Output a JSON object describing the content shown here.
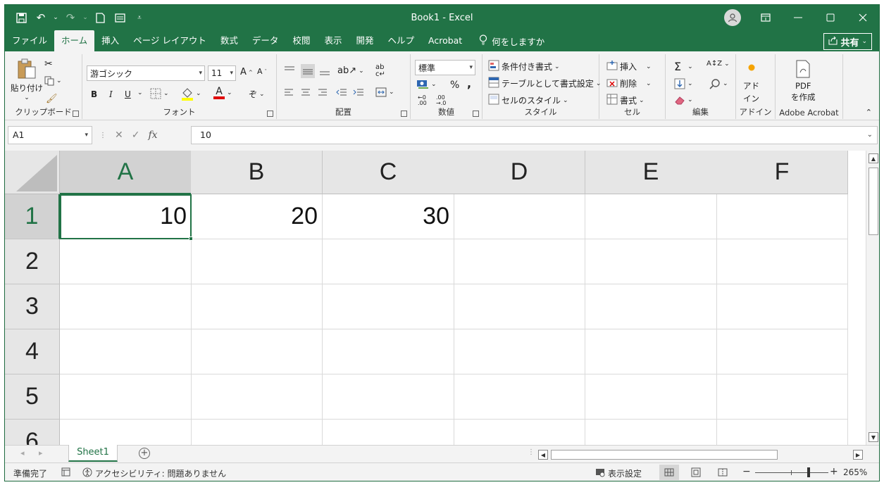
{
  "window": {
    "title": "Book1  -  Excel",
    "quick_access": [
      "save-icon",
      "undo-icon",
      "redo-icon",
      "new-file-icon",
      "form-icon",
      "customize-icon"
    ]
  },
  "menu_tabs": [
    "ファイル",
    "ホーム",
    "挿入",
    "ページ レイアウト",
    "数式",
    "データ",
    "校閲",
    "表示",
    "開発",
    "ヘルプ",
    "Acrobat"
  ],
  "active_tab": "ホーム",
  "tell_me": "何をしますか",
  "share_label": "共有",
  "ribbon": {
    "clipboard": {
      "label": "クリップボード",
      "paste": "貼り付け"
    },
    "font": {
      "label": "フォント",
      "font_name": "游ゴシック",
      "font_size": "11"
    },
    "alignment": {
      "label": "配置"
    },
    "number": {
      "label": "数値",
      "format": "標準",
      "percent": "%",
      "comma": ","
    },
    "styles": {
      "label": "スタイル",
      "conditional": "条件付き書式",
      "as_table": "テーブルとして書式設定",
      "cell_styles": "セルのスタイル"
    },
    "cells": {
      "label": "セル",
      "insert": "挿入",
      "delete": "削除",
      "format": "書式"
    },
    "editing": {
      "label": "編集"
    },
    "addins": {
      "label": "アドイン",
      "button_line1": "アド",
      "button_line2": "イン"
    },
    "acrobat": {
      "label": "Adobe Acrobat",
      "button_line1": "PDF",
      "button_line2": "を作成"
    }
  },
  "formula_bar": {
    "name_box": "A1",
    "fx": "fx",
    "value": "10"
  },
  "grid": {
    "columns": [
      "A",
      "B",
      "C",
      "D",
      "E",
      "F"
    ],
    "rows": [
      "1",
      "2",
      "3",
      "4",
      "5",
      "6"
    ],
    "cells": {
      "A1": "10",
      "B1": "20",
      "C1": "30"
    },
    "selected_cell": "A1"
  },
  "sheets": [
    "Sheet1"
  ],
  "status": {
    "ready": "準備完了",
    "accessibility": "アクセシビリティ: 問題ありません",
    "display_settings": "表示設定",
    "zoom": "265%",
    "zoom_minus": "−",
    "zoom_plus": "+"
  },
  "colors": {
    "accent": "#217346"
  }
}
